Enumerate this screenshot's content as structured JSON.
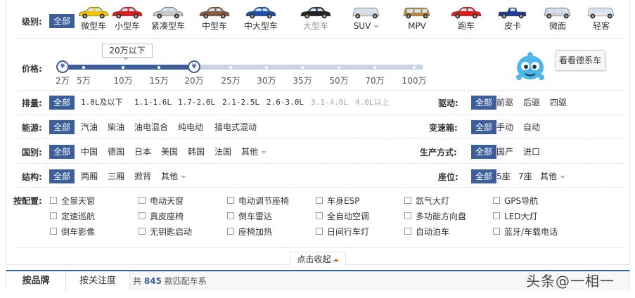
{
  "level": {
    "label": "级别:",
    "all": "全部",
    "cars": [
      {
        "label": "微型车",
        "icon": "mini-car-icon",
        "color": "#f2c300",
        "disabled": false
      },
      {
        "label": "小型车",
        "icon": "small-car-icon",
        "color": "#d81e1e",
        "disabled": false
      },
      {
        "label": "紧凑型车",
        "icon": "compact-car-icon",
        "color": "#c8c8c8",
        "disabled": false
      },
      {
        "label": "中型车",
        "icon": "midsize-car-icon",
        "color": "#8a5a3c",
        "disabled": false
      },
      {
        "label": "中大型车",
        "icon": "large-car-icon",
        "color": "#1f4fa8",
        "disabled": false
      },
      {
        "label": "大型车",
        "icon": "fullsize-car-icon",
        "color": "#222222",
        "disabled": true
      },
      {
        "label": "SUV",
        "icon": "suv-icon",
        "color": "#d8d8d8",
        "disabled": false,
        "dropdown": true
      },
      {
        "label": "MPV",
        "icon": "mpv-icon",
        "color": "#b8893a",
        "disabled": false
      },
      {
        "label": "跑车",
        "icon": "sports-car-icon",
        "color": "#d81e1e",
        "disabled": false
      },
      {
        "label": "皮卡",
        "icon": "pickup-icon",
        "color": "#1f3f9a",
        "disabled": false
      },
      {
        "label": "微面",
        "icon": "minivan-icon",
        "color": "#d0d0d0",
        "disabled": false
      },
      {
        "label": "轻客",
        "icon": "light-bus-icon",
        "color": "#e8e8e8",
        "disabled": false
      }
    ]
  },
  "price": {
    "label": "价格:",
    "tooltip": "20万以下",
    "ticks": [
      "2万",
      "5万",
      "10万",
      "15万",
      "20万",
      "25万",
      "30万",
      "35万",
      "50万",
      "70万",
      "100万"
    ],
    "knob_symbol": "¥",
    "selected_from_index": 0,
    "selected_to_index": 4,
    "promo": "看看德系车",
    "mascot_icon": "blue-mascot-icon"
  },
  "displacement": {
    "label": "排量:",
    "all": "全部",
    "options": [
      "1.0L及以下",
      "1.1-1.6L",
      "1.7-2.0L",
      "2.1-2.5L",
      "2.6-3.0L",
      "3.1-4.0L",
      "4.0L以上"
    ]
  },
  "drive": {
    "label": "驱动:",
    "all": "全部",
    "options": [
      "前驱",
      "后驱",
      "四驱"
    ]
  },
  "energy": {
    "label": "能源:",
    "all": "全部",
    "options": [
      "汽油",
      "柴油",
      "油电混合",
      "纯电动",
      "插电式混动"
    ]
  },
  "gearbox": {
    "label": "变速箱:",
    "all": "全部",
    "options": [
      "手动",
      "自动"
    ]
  },
  "country": {
    "label": "国别:",
    "all": "全部",
    "options": [
      "中国",
      "德国",
      "日本",
      "美国",
      "韩国",
      "法国",
      "其他"
    ]
  },
  "production": {
    "label": "生产方式:",
    "all": "全部",
    "options": [
      "国产",
      "进口"
    ]
  },
  "structure": {
    "label": "结构:",
    "all": "全部",
    "options": [
      "两厢",
      "三厢",
      "掀背",
      "其他"
    ]
  },
  "seats": {
    "label": "座位:",
    "all": "全部",
    "options": [
      "5座",
      "7座",
      "其他"
    ]
  },
  "config": {
    "label": "按配置:",
    "items": [
      "全景天窗",
      "电动天窗",
      "电动调节座椅",
      "车身ESP",
      "氙气大灯",
      "GPS导航",
      "定速巡航",
      "真皮座椅",
      "倒车雷达",
      "全自动空调",
      "多功能方向盘",
      "LED大灯",
      "倒车影像",
      "无钥匙启动",
      "座椅加热",
      "日间行车灯",
      "自动泊车",
      "蓝牙/车载电话"
    ]
  },
  "collapse_label": "点击收起",
  "tabs": {
    "brand": "按品牌",
    "attention": "按关注度"
  },
  "count": {
    "prefix": "共",
    "number": "845",
    "suffix": "款匹配车系"
  },
  "watermark": "头条@一相一"
}
